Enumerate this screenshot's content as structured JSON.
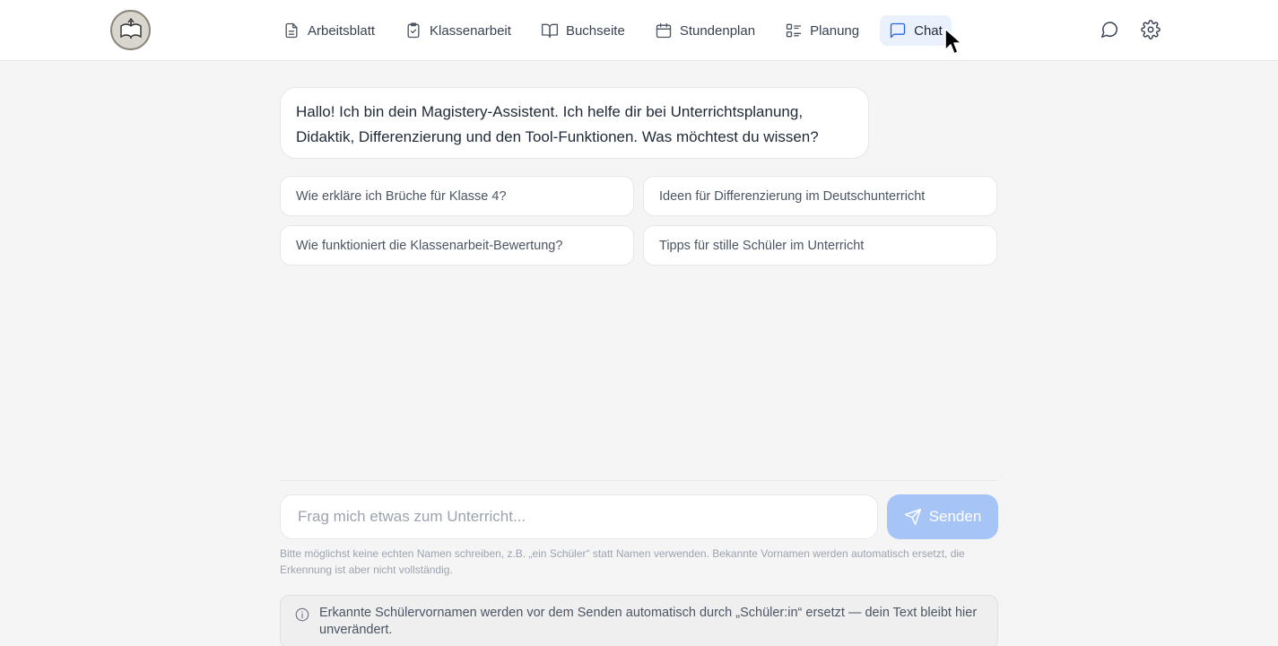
{
  "nav": {
    "items": [
      {
        "label": "Arbeitsblatt",
        "icon": "document-icon"
      },
      {
        "label": "Klassenarbeit",
        "icon": "clipboard-check-icon"
      },
      {
        "label": "Buchseite",
        "icon": "book-open-icon"
      },
      {
        "label": "Stundenplan",
        "icon": "calendar-icon"
      },
      {
        "label": "Planung",
        "icon": "list-checks-icon"
      },
      {
        "label": "Chat",
        "icon": "chat-icon",
        "active": true
      }
    ]
  },
  "header_icons": [
    "chat-bubble-icon",
    "gear-icon"
  ],
  "chat": {
    "assistant_message": "Hallo! Ich bin dein Magistery-Assistent. Ich helfe dir bei Unterrichtsplanung, Didaktik, Differenzierung und den Tool-Funktionen. Was möchtest du wissen?",
    "suggestions": [
      "Wie erkläre ich Brüche für Klasse 4?",
      "Ideen für Differenzierung im Deutschunterricht",
      "Wie funktioniert die Klassenarbeit-Bewertung?",
      "Tipps für stille Schüler im Unterricht"
    ]
  },
  "composer": {
    "placeholder": "Frag mich etwas zum Unterricht...",
    "value": "",
    "send_label": "Senden",
    "hint": "Bitte möglichst keine echten Namen schreiben, z.B. „ein Schüler“ statt Namen verwenden. Bekannte Vornamen werden automatisch ersetzt, die Erkennung ist aber nicht vollständig."
  },
  "notice": {
    "text": "Erkannte Schülervornamen werden vor dem Senden automatisch durch „Schüler:in“ ersetzt — dein Text bleibt hier unverändert."
  },
  "colors": {
    "accent": "#2563eb",
    "active_tab_bg": "#eaf1fd",
    "send_disabled": "#a7c4f7"
  }
}
